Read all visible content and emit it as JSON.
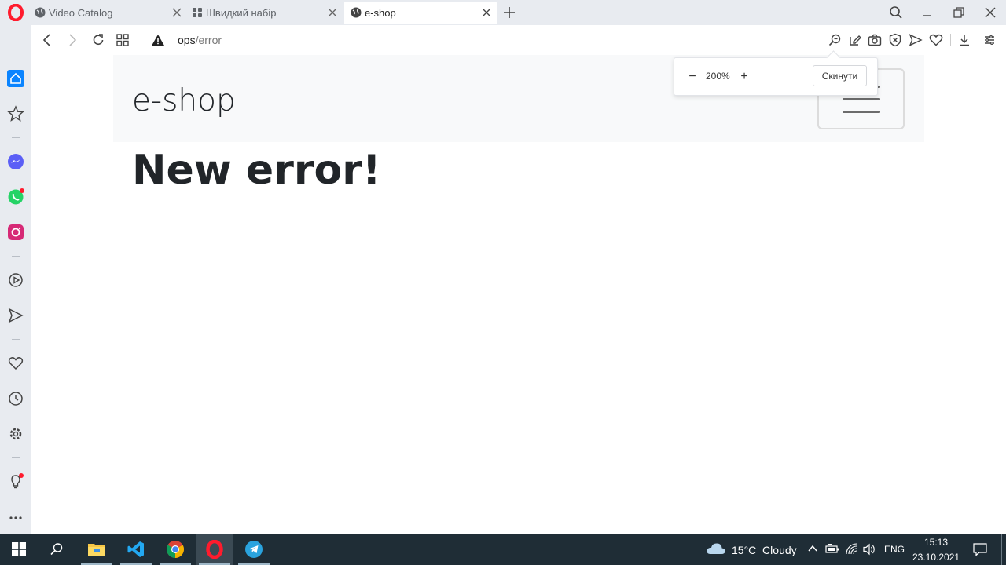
{
  "tabs": [
    {
      "title": "Video Catalog",
      "icon": "globe-icon",
      "active": false
    },
    {
      "title": "Швидкий набір",
      "icon": "grid-icon",
      "active": false
    },
    {
      "title": "e-shop",
      "icon": "globe-icon",
      "active": true
    }
  ],
  "address": {
    "host": "ops",
    "path": "/error"
  },
  "zoom": {
    "minus": "−",
    "value": "200%",
    "plus": "+",
    "reset_label": "Скинути"
  },
  "page": {
    "brand": "e-shop",
    "heading": "New error!"
  },
  "taskbar": {
    "weather": "15°C  Cloudy",
    "language": "ENG",
    "time": "15:13",
    "date": "23.10.2021"
  },
  "colors": {
    "opera_red": "#ff1b2d",
    "sidebar_bg": "#e8ebf0",
    "taskbar_bg": "#1f2d36",
    "home_accent": "#0a84ff"
  }
}
